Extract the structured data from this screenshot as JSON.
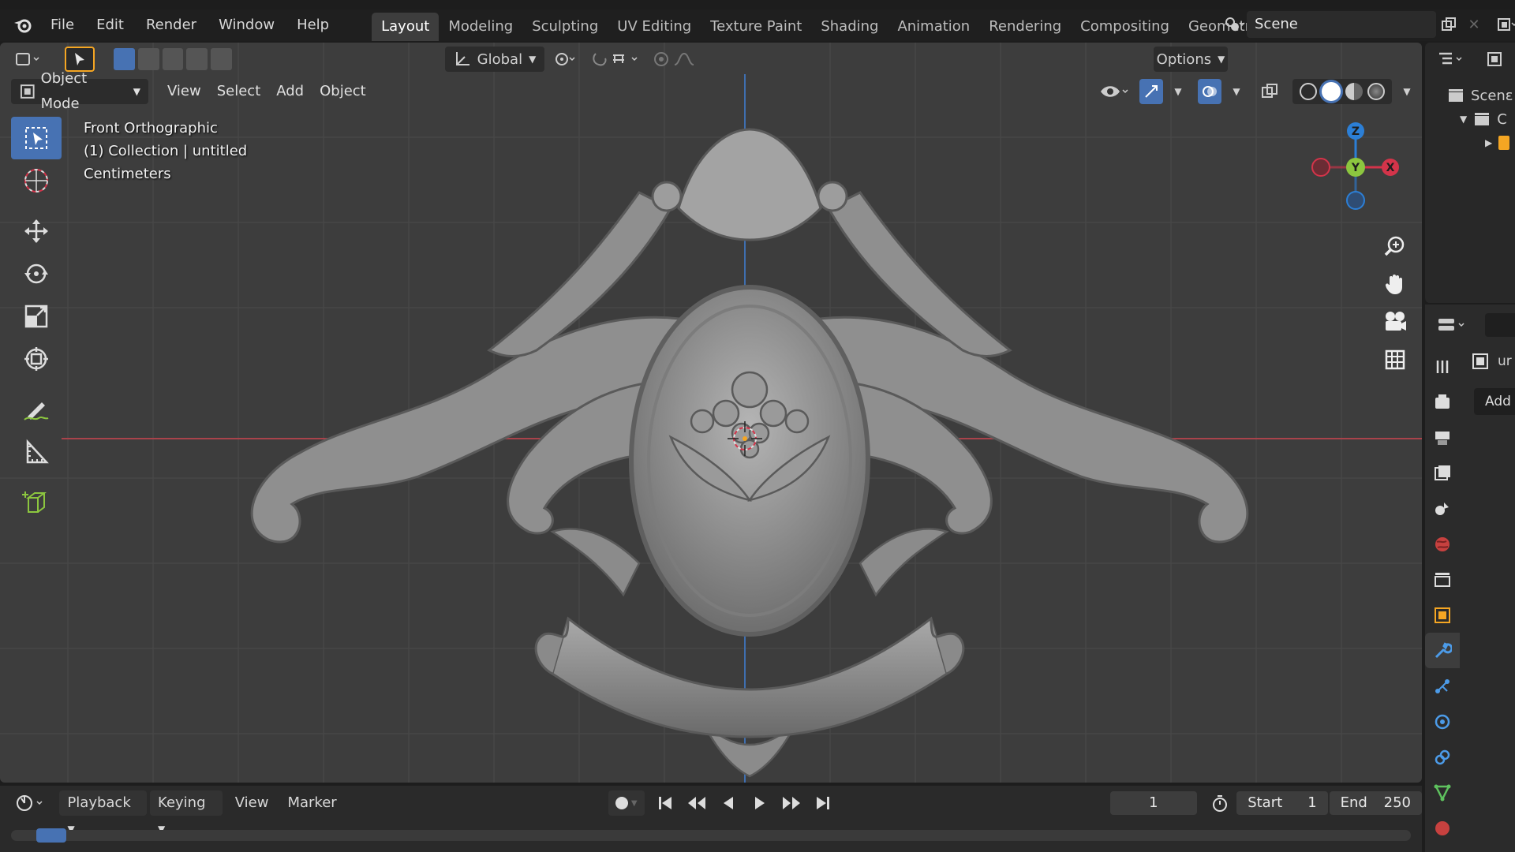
{
  "menu": {
    "file": "File",
    "edit": "Edit",
    "render": "Render",
    "window": "Window",
    "help": "Help"
  },
  "workspaces": [
    "Layout",
    "Modeling",
    "Sculpting",
    "UV Editing",
    "Texture Paint",
    "Shading",
    "Animation",
    "Rendering",
    "Compositing",
    "Geometry Nod"
  ],
  "scene": {
    "name": "Scene"
  },
  "tool_header": {
    "orientation": "Global",
    "options": "Options"
  },
  "view_header": {
    "mode": "Object Mode",
    "view": "View",
    "select": "Select",
    "add": "Add",
    "object": "Object"
  },
  "overlay": {
    "view_name": "Front Orthographic",
    "collection": "(1) Collection | untitled",
    "units": "Centimeters"
  },
  "gizmo": {
    "z": "Z",
    "y": "Y",
    "x": "X"
  },
  "timeline": {
    "playback": "Playback",
    "keying": "Keying",
    "view": "View",
    "marker": "Marker",
    "current_frame": "1",
    "start_label": "Start",
    "start_value": "1",
    "end_label": "End",
    "end_value": "250"
  },
  "outliner": {
    "scene_label": "Scenε",
    "collection_label": "C"
  },
  "properties": {
    "object_name": "ur",
    "add_modifier": "Add M"
  },
  "colors": {
    "accent": "#4772b3",
    "x_axis": "#d4344a",
    "y_axis": "#8cc63f",
    "z_axis": "#2c7fd6",
    "viewport_bg": "#3d3d3d"
  }
}
